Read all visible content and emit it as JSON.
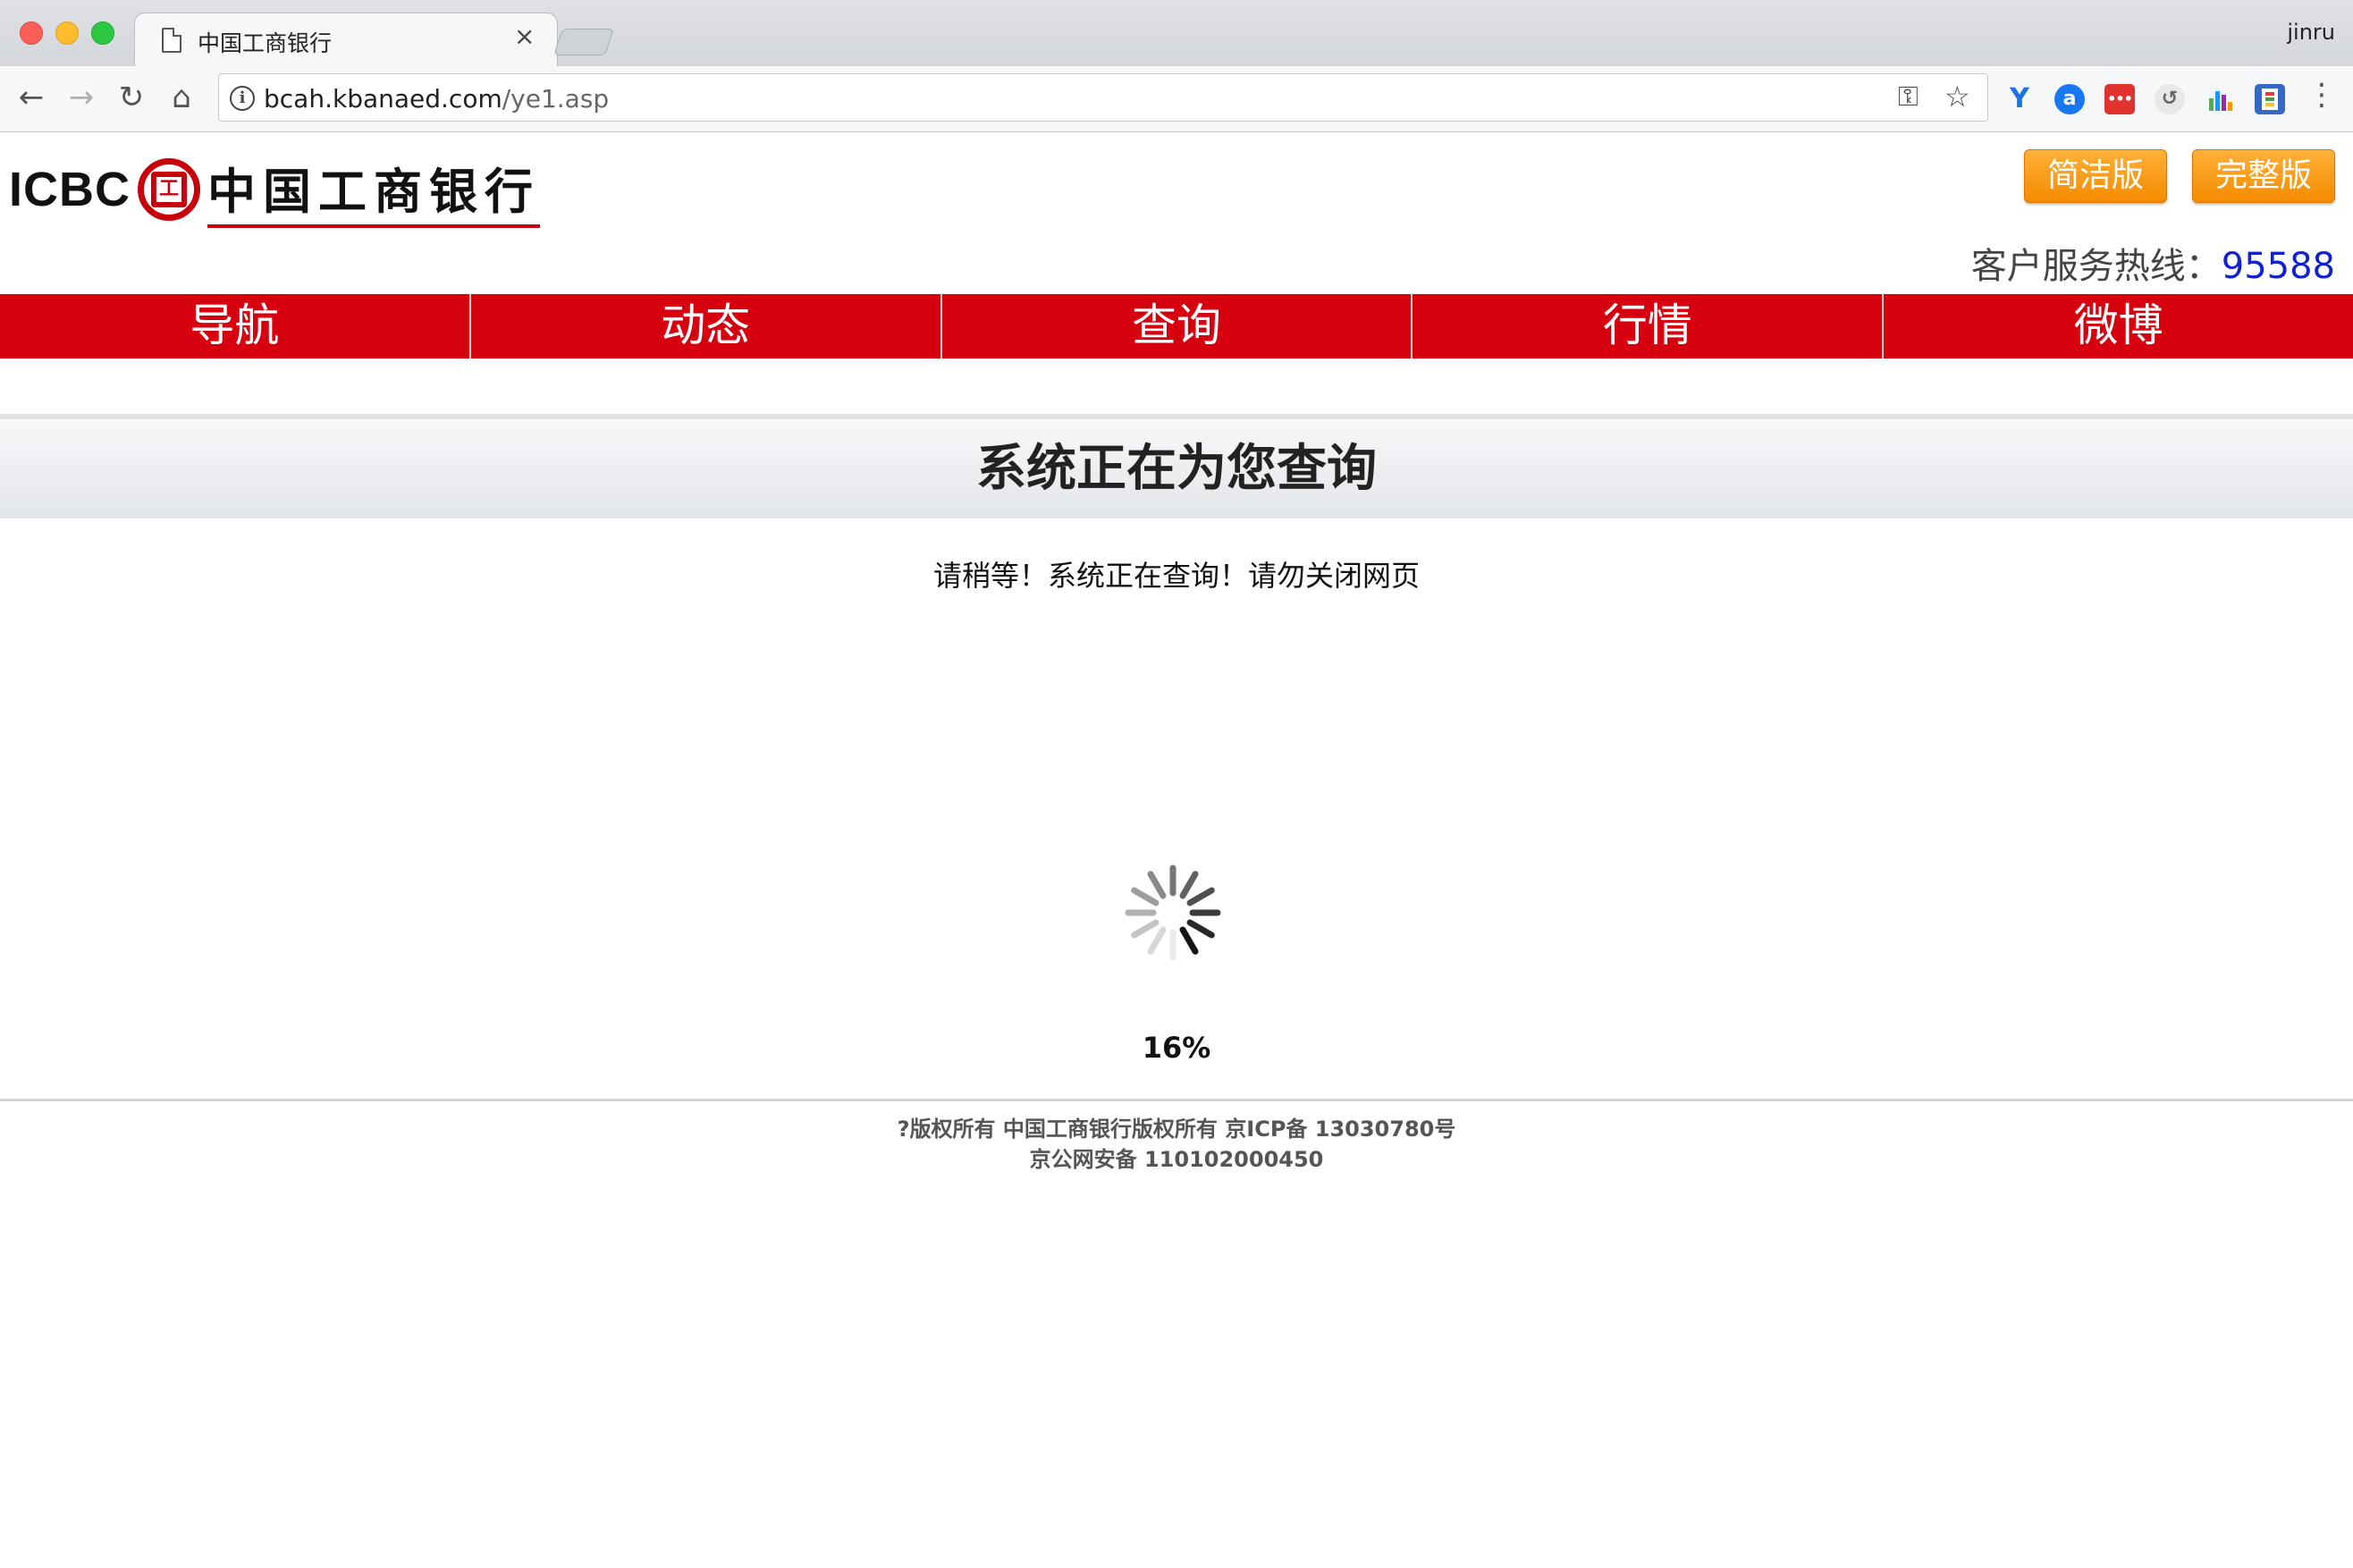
{
  "browser": {
    "tab_title": "中国工商银行",
    "tab_close": "×",
    "user": "jinru",
    "url_host": "bcah.kbanaed.com",
    "url_path": "/ye1.asp",
    "icons": {
      "back": "←",
      "forward": "→",
      "reload": "↻",
      "home": "⌂",
      "info": "i",
      "key": "⚿",
      "star": "☆",
      "menu": "⋮"
    },
    "extensions": [
      "Y",
      "a",
      "•••",
      "↺",
      "",
      ""
    ]
  },
  "header": {
    "logo_latin": "ICBC",
    "logo_seal": "工",
    "logo_chinese": "中国工商银行",
    "buttons": {
      "simple": "简洁版",
      "full": "完整版"
    },
    "hotline_label": "客户服务热线：",
    "hotline_number": "95588",
    "accent_color": "#d6000f",
    "button_color": "#f58a00"
  },
  "nav": {
    "items": [
      "导航",
      "动态",
      "查询",
      "行情",
      "微博"
    ]
  },
  "main": {
    "heading": "系统正在为您查询",
    "wait_message": "请稍等！系统正在查询！请勿关闭网页",
    "progress_percent": "16%",
    "progress_value": 16
  },
  "footer": {
    "line1": "?版权所有 中国工商银行版权所有 京ICP备 13030780号",
    "line2": "京公网安备 110102000450"
  }
}
